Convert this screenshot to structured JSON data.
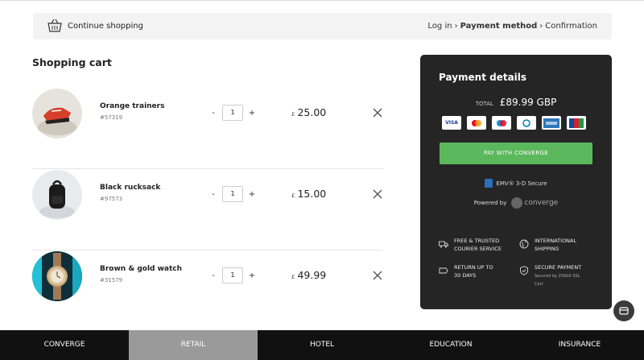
{
  "header": {
    "continue_label": "Continue shopping",
    "breadcrumb": [
      "Log in",
      "Payment method",
      "Confirmation"
    ],
    "breadcrumb_separator": "›"
  },
  "cart": {
    "title": "Shopping cart",
    "items": [
      {
        "name": "Orange trainers",
        "sku": "#57319",
        "qty": "1",
        "currency": "£",
        "price": "25.00",
        "minus": "-",
        "plus": "+"
      },
      {
        "name": "Black rucksack",
        "sku": "#97573",
        "qty": "1",
        "currency": "£",
        "price": "15.00",
        "minus": "-",
        "plus": "+"
      },
      {
        "name": "Brown & gold watch",
        "sku": "#31579",
        "qty": "1",
        "currency": "£",
        "price": "49.99",
        "minus": "-",
        "plus": "+"
      }
    ]
  },
  "payment": {
    "title": "Payment details",
    "total_label": "TOTAL",
    "total_value": "£89.99 GBP",
    "card_icons": [
      "VISA",
      "MC",
      "Maestro",
      "Diners",
      "AMEX",
      "JCB"
    ],
    "pay_button": "PAY WITH CONVERGE",
    "emv_text": "EMV® 3-D Secure",
    "powered_by": "Powered by",
    "powered_logo": "converge",
    "features": [
      {
        "icon": "truck-icon",
        "line1": "FREE & TRUSTED",
        "line2": "COURIER SERVICE"
      },
      {
        "icon": "globe-icon",
        "line1": "INTERNATIONAL",
        "line2": "SHIPPING"
      },
      {
        "icon": "tag-icon",
        "line1": "RETURN UP TO",
        "line2": "30 DAYS"
      },
      {
        "icon": "shield-icon",
        "line1": "SECURE PAYMENT",
        "sub1": "Secured by 256bit SSL",
        "sub2": "Cert"
      }
    ]
  },
  "bottom_nav": {
    "tabs": [
      "CONVERGE",
      "RETAIL",
      "HOTEL",
      "EDUCATION",
      "INSURANCE"
    ],
    "active": "RETAIL"
  },
  "colors": {
    "pay_button": "#5cb85c",
    "panel": "#252525",
    "nav_bg": "#111111",
    "nav_active": "#9a9a9a"
  }
}
